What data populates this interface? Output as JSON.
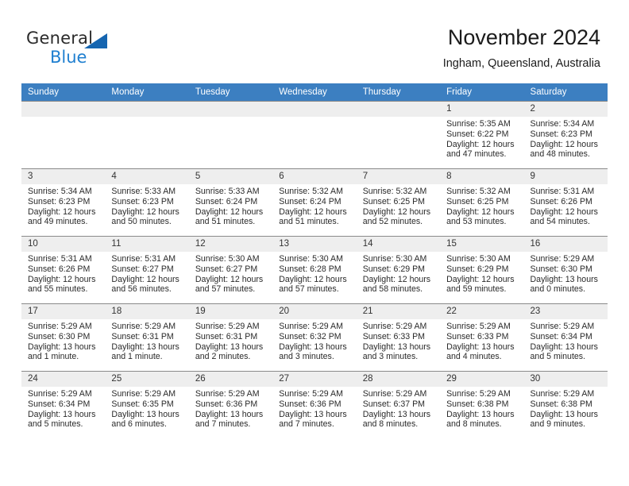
{
  "brand": {
    "name_top": "General",
    "name_bottom": "Blue",
    "triangle_color": "#1565b0",
    "blue_text_color": "#1f7fd0"
  },
  "header": {
    "title": "November 2024",
    "subtitle": "Ingham, Queensland, Australia"
  },
  "theme": {
    "header_row_bg": "#3c7fc1",
    "header_row_text": "#ffffff",
    "daynum_bg": "#eeeeee",
    "cell_bg": "#ffffff",
    "grid_line": "#7e7e7e"
  },
  "calendar": {
    "weekday_headers": [
      "Sunday",
      "Monday",
      "Tuesday",
      "Wednesday",
      "Thursday",
      "Friday",
      "Saturday"
    ],
    "labels": {
      "sunrise": "Sunrise:",
      "sunset": "Sunset:",
      "daylight": "Daylight:"
    },
    "weeks": [
      [
        {
          "day": "",
          "empty": true
        },
        {
          "day": "",
          "empty": true
        },
        {
          "day": "",
          "empty": true
        },
        {
          "day": "",
          "empty": true
        },
        {
          "day": "",
          "empty": true
        },
        {
          "day": "1",
          "sunrise": "Sunrise: 5:35 AM",
          "sunset": "Sunset: 6:22 PM",
          "daylight": "Daylight: 12 hours and 47 minutes."
        },
        {
          "day": "2",
          "sunrise": "Sunrise: 5:34 AM",
          "sunset": "Sunset: 6:23 PM",
          "daylight": "Daylight: 12 hours and 48 minutes."
        }
      ],
      [
        {
          "day": "3",
          "sunrise": "Sunrise: 5:34 AM",
          "sunset": "Sunset: 6:23 PM",
          "daylight": "Daylight: 12 hours and 49 minutes."
        },
        {
          "day": "4",
          "sunrise": "Sunrise: 5:33 AM",
          "sunset": "Sunset: 6:23 PM",
          "daylight": "Daylight: 12 hours and 50 minutes."
        },
        {
          "day": "5",
          "sunrise": "Sunrise: 5:33 AM",
          "sunset": "Sunset: 6:24 PM",
          "daylight": "Daylight: 12 hours and 51 minutes."
        },
        {
          "day": "6",
          "sunrise": "Sunrise: 5:32 AM",
          "sunset": "Sunset: 6:24 PM",
          "daylight": "Daylight: 12 hours and 51 minutes."
        },
        {
          "day": "7",
          "sunrise": "Sunrise: 5:32 AM",
          "sunset": "Sunset: 6:25 PM",
          "daylight": "Daylight: 12 hours and 52 minutes."
        },
        {
          "day": "8",
          "sunrise": "Sunrise: 5:32 AM",
          "sunset": "Sunset: 6:25 PM",
          "daylight": "Daylight: 12 hours and 53 minutes."
        },
        {
          "day": "9",
          "sunrise": "Sunrise: 5:31 AM",
          "sunset": "Sunset: 6:26 PM",
          "daylight": "Daylight: 12 hours and 54 minutes."
        }
      ],
      [
        {
          "day": "10",
          "sunrise": "Sunrise: 5:31 AM",
          "sunset": "Sunset: 6:26 PM",
          "daylight": "Daylight: 12 hours and 55 minutes."
        },
        {
          "day": "11",
          "sunrise": "Sunrise: 5:31 AM",
          "sunset": "Sunset: 6:27 PM",
          "daylight": "Daylight: 12 hours and 56 minutes."
        },
        {
          "day": "12",
          "sunrise": "Sunrise: 5:30 AM",
          "sunset": "Sunset: 6:27 PM",
          "daylight": "Daylight: 12 hours and 57 minutes."
        },
        {
          "day": "13",
          "sunrise": "Sunrise: 5:30 AM",
          "sunset": "Sunset: 6:28 PM",
          "daylight": "Daylight: 12 hours and 57 minutes."
        },
        {
          "day": "14",
          "sunrise": "Sunrise: 5:30 AM",
          "sunset": "Sunset: 6:29 PM",
          "daylight": "Daylight: 12 hours and 58 minutes."
        },
        {
          "day": "15",
          "sunrise": "Sunrise: 5:30 AM",
          "sunset": "Sunset: 6:29 PM",
          "daylight": "Daylight: 12 hours and 59 minutes."
        },
        {
          "day": "16",
          "sunrise": "Sunrise: 5:29 AM",
          "sunset": "Sunset: 6:30 PM",
          "daylight": "Daylight: 13 hours and 0 minutes."
        }
      ],
      [
        {
          "day": "17",
          "sunrise": "Sunrise: 5:29 AM",
          "sunset": "Sunset: 6:30 PM",
          "daylight": "Daylight: 13 hours and 1 minute."
        },
        {
          "day": "18",
          "sunrise": "Sunrise: 5:29 AM",
          "sunset": "Sunset: 6:31 PM",
          "daylight": "Daylight: 13 hours and 1 minute."
        },
        {
          "day": "19",
          "sunrise": "Sunrise: 5:29 AM",
          "sunset": "Sunset: 6:31 PM",
          "daylight": "Daylight: 13 hours and 2 minutes."
        },
        {
          "day": "20",
          "sunrise": "Sunrise: 5:29 AM",
          "sunset": "Sunset: 6:32 PM",
          "daylight": "Daylight: 13 hours and 3 minutes."
        },
        {
          "day": "21",
          "sunrise": "Sunrise: 5:29 AM",
          "sunset": "Sunset: 6:33 PM",
          "daylight": "Daylight: 13 hours and 3 minutes."
        },
        {
          "day": "22",
          "sunrise": "Sunrise: 5:29 AM",
          "sunset": "Sunset: 6:33 PM",
          "daylight": "Daylight: 13 hours and 4 minutes."
        },
        {
          "day": "23",
          "sunrise": "Sunrise: 5:29 AM",
          "sunset": "Sunset: 6:34 PM",
          "daylight": "Daylight: 13 hours and 5 minutes."
        }
      ],
      [
        {
          "day": "24",
          "sunrise": "Sunrise: 5:29 AM",
          "sunset": "Sunset: 6:34 PM",
          "daylight": "Daylight: 13 hours and 5 minutes."
        },
        {
          "day": "25",
          "sunrise": "Sunrise: 5:29 AM",
          "sunset": "Sunset: 6:35 PM",
          "daylight": "Daylight: 13 hours and 6 minutes."
        },
        {
          "day": "26",
          "sunrise": "Sunrise: 5:29 AM",
          "sunset": "Sunset: 6:36 PM",
          "daylight": "Daylight: 13 hours and 7 minutes."
        },
        {
          "day": "27",
          "sunrise": "Sunrise: 5:29 AM",
          "sunset": "Sunset: 6:36 PM",
          "daylight": "Daylight: 13 hours and 7 minutes."
        },
        {
          "day": "28",
          "sunrise": "Sunrise: 5:29 AM",
          "sunset": "Sunset: 6:37 PM",
          "daylight": "Daylight: 13 hours and 8 minutes."
        },
        {
          "day": "29",
          "sunrise": "Sunrise: 5:29 AM",
          "sunset": "Sunset: 6:38 PM",
          "daylight": "Daylight: 13 hours and 8 minutes."
        },
        {
          "day": "30",
          "sunrise": "Sunrise: 5:29 AM",
          "sunset": "Sunset: 6:38 PM",
          "daylight": "Daylight: 13 hours and 9 minutes."
        }
      ]
    ]
  }
}
